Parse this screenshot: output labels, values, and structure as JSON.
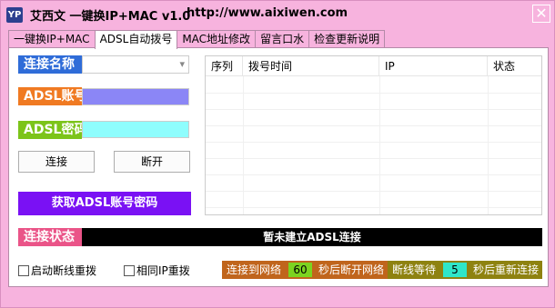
{
  "window": {
    "icon_text": "YP",
    "title": "艾西文 一键换IP+MAC v1.0",
    "url": "http://www.aixiwen.com",
    "close_glyph": "✕"
  },
  "tabs": [
    {
      "label": "一键换IP+MAC",
      "active": false
    },
    {
      "label": "ADSL自动拨号",
      "active": true
    },
    {
      "label": "MAC地址修改",
      "active": false
    },
    {
      "label": "留言口水",
      "active": false
    },
    {
      "label": "检查更新说明",
      "active": false
    }
  ],
  "form": {
    "conn_name_label": "连接名称",
    "conn_name_value": "",
    "adsl_account_label": "ADSL账号",
    "adsl_account_value": "",
    "adsl_password_label": "ADSL密码",
    "adsl_password_value": "",
    "connect_button": "连接",
    "disconnect_button": "断开",
    "get_account_button": "获取ADSL账号密码",
    "dropdown_glyph": "▾"
  },
  "table": {
    "columns": [
      "序列",
      "拨号时间",
      "IP",
      "状态"
    ],
    "rows": []
  },
  "status": {
    "label": "连接状态",
    "text": "暂未建立ADSL连接"
  },
  "options": {
    "auto_reconnect_label": "启动断线重拨",
    "auto_reconnect_checked": false,
    "same_ip_redial_label": "相同IP重拨",
    "same_ip_redial_checked": false
  },
  "timer": {
    "connected_label": "连接到网络",
    "disconnect_seconds": "60",
    "after_disconnect_label": "秒后断开网络",
    "wait_label": "断线等待",
    "reconnect_seconds": "5",
    "after_reconnect_label": "秒后重新连接"
  },
  "colors": {
    "window_bg": "#f7b3de",
    "conn_name_label": "#2f6cd8",
    "adsl_account_label": "#f07a22",
    "adsl_password_label": "#7cc41a",
    "status_label": "#ea5488",
    "account_field": "#8b86f6",
    "password_field": "#8ffdfd",
    "get_button": "#7a11f4",
    "timer_orange": "#c0651c",
    "timer_olive": "#8e8210"
  }
}
